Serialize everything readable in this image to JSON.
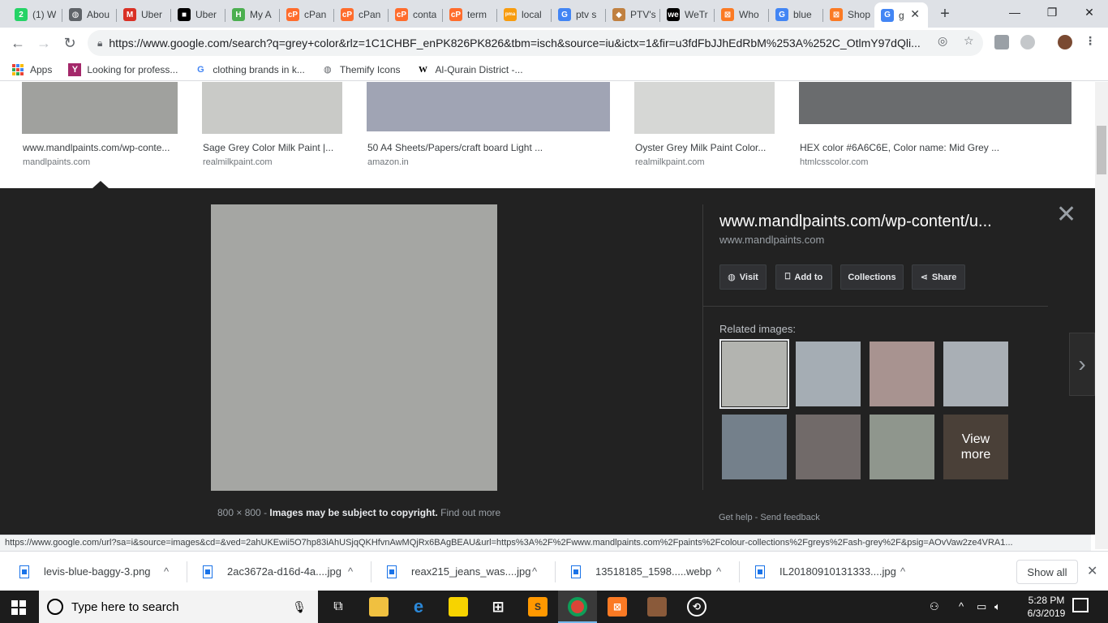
{
  "tabs": [
    {
      "label": "(1) W",
      "icon": "whatsapp-icon",
      "color": "#25d366",
      "glyph": "2"
    },
    {
      "label": "Abou",
      "icon": "globe-icon",
      "color": "#5f6368",
      "glyph": "◍"
    },
    {
      "label": "Uber",
      "icon": "gmail-icon",
      "color": "#d93025",
      "glyph": "M"
    },
    {
      "label": "Uber",
      "icon": "uber-icon",
      "color": "#000000",
      "glyph": "■"
    },
    {
      "label": "My A",
      "icon": "hostinger-icon",
      "color": "#4caf50",
      "glyph": "H"
    },
    {
      "label": "cPan",
      "icon": "cpanel-icon",
      "color": "#ff6c2c",
      "glyph": "cP"
    },
    {
      "label": "cPan",
      "icon": "cpanel-icon",
      "color": "#ff6c2c",
      "glyph": "cP"
    },
    {
      "label": "conta",
      "icon": "cpanel-icon",
      "color": "#ff6c2c",
      "glyph": "cP"
    },
    {
      "label": "term",
      "icon": "cpanel-icon",
      "color": "#ff6c2c",
      "glyph": "cP"
    },
    {
      "label": "local",
      "icon": "phpmyadmin-icon",
      "color": "#f89c0e",
      "glyph": "pma"
    },
    {
      "label": "ptv s",
      "icon": "google-icon",
      "color": "#4285f4",
      "glyph": "G"
    },
    {
      "label": "PTV's",
      "icon": "ptv-icon",
      "color": "#c08040",
      "glyph": "◆"
    },
    {
      "label": "WeTr",
      "icon": "wetransfer-icon",
      "color": "#000000",
      "glyph": "we"
    },
    {
      "label": "Who",
      "icon": "xampp-icon",
      "color": "#fb7a24",
      "glyph": "⊠"
    },
    {
      "label": "blue",
      "icon": "google-icon",
      "color": "#4285f4",
      "glyph": "G"
    },
    {
      "label": "Shop",
      "icon": "xampp-icon",
      "color": "#fb7a24",
      "glyph": "⊠"
    },
    {
      "label": "g",
      "icon": "google-icon",
      "color": "#4285f4",
      "glyph": "G",
      "active": true
    }
  ],
  "toolbar": {
    "url": "https://www.google.com/search?q=grey+color&rlz=1C1CHBF_enPK826PK826&tbm=isch&source=iu&ictx=1&fir=u3fdFbJJhEdRbM%253A%252C_OtlmY97dQli..."
  },
  "bookmarks": [
    {
      "label": "Apps",
      "icon": "apps-grid-icon"
    },
    {
      "label": "Looking for profess...",
      "icon": "yoast-icon"
    },
    {
      "label": "clothing brands in k...",
      "icon": "google-icon"
    },
    {
      "label": "Themify Icons",
      "icon": "globe-icon"
    },
    {
      "label": "Al-Qurain District -...",
      "icon": "wikipedia-icon"
    }
  ],
  "results": [
    {
      "title": "www.mandlpaints.com/wp-conte...",
      "source": "mandlpaints.com",
      "color": "#a0a19e"
    },
    {
      "title": "Sage Grey Color Milk Paint |...",
      "source": "realmilkpaint.com",
      "color": "#c9cac7"
    },
    {
      "title": "50 A4 Sheets/Papers/craft board Light ...",
      "source": "amazon.in",
      "color": "#a0a4b4"
    },
    {
      "title": "Oyster Grey Milk Paint Color...",
      "source": "realmilkpaint.com",
      "color": "#d6d7d5"
    },
    {
      "title": "HEX color #6A6C6E, Color name: Mid Grey ...",
      "source": "htmlcsscolor.com",
      "color": "#6a6c6e"
    }
  ],
  "viewer": {
    "image_color": "#a5a6a3",
    "title": "www.mandlpaints.com/wp-content/u...",
    "source": "www.mandlpaints.com",
    "dimensions": "800 × 800",
    "dash": "-",
    "copyright": "Images may be subject to copyright.",
    "find_out_more": "Find out more",
    "actions": {
      "visit": "Visit",
      "add_to": "Add to",
      "collections": "Collections",
      "share": "Share"
    },
    "related_label": "Related images:",
    "related": [
      "#b3b4b0",
      "#a5adb4",
      "#a89390",
      "#a9afb5",
      "#74808b",
      "#716a69",
      "#8f968d"
    ],
    "view_more": "View more",
    "get_help": "Get help",
    "send_feedback": "Send feedback"
  },
  "status_url": "https://www.google.com/url?sa=i&source=images&cd=&ved=2ahUKEwii5O7hp83iAhUSjqQKHfvnAwMQjRx6BAgBEAU&url=https%3A%2F%2Fwww.mandlpaints.com%2Fpaints%2Fcolour-collections%2Fgreys%2Fash-grey%2F&psig=AOvVaw2ze4VRA1...",
  "downloads": {
    "items": [
      "levis-blue-baggy-3.png",
      "2ac3672a-d16d-4a....jpg",
      "reax215_jeans_was....jpg",
      "13518185_1598.....webp",
      "IL20180910131333....jpg"
    ],
    "show_all": "Show all"
  },
  "taskbar": {
    "search_placeholder": "Type here to search",
    "time": "5:28 PM",
    "date": "6/3/2019"
  }
}
